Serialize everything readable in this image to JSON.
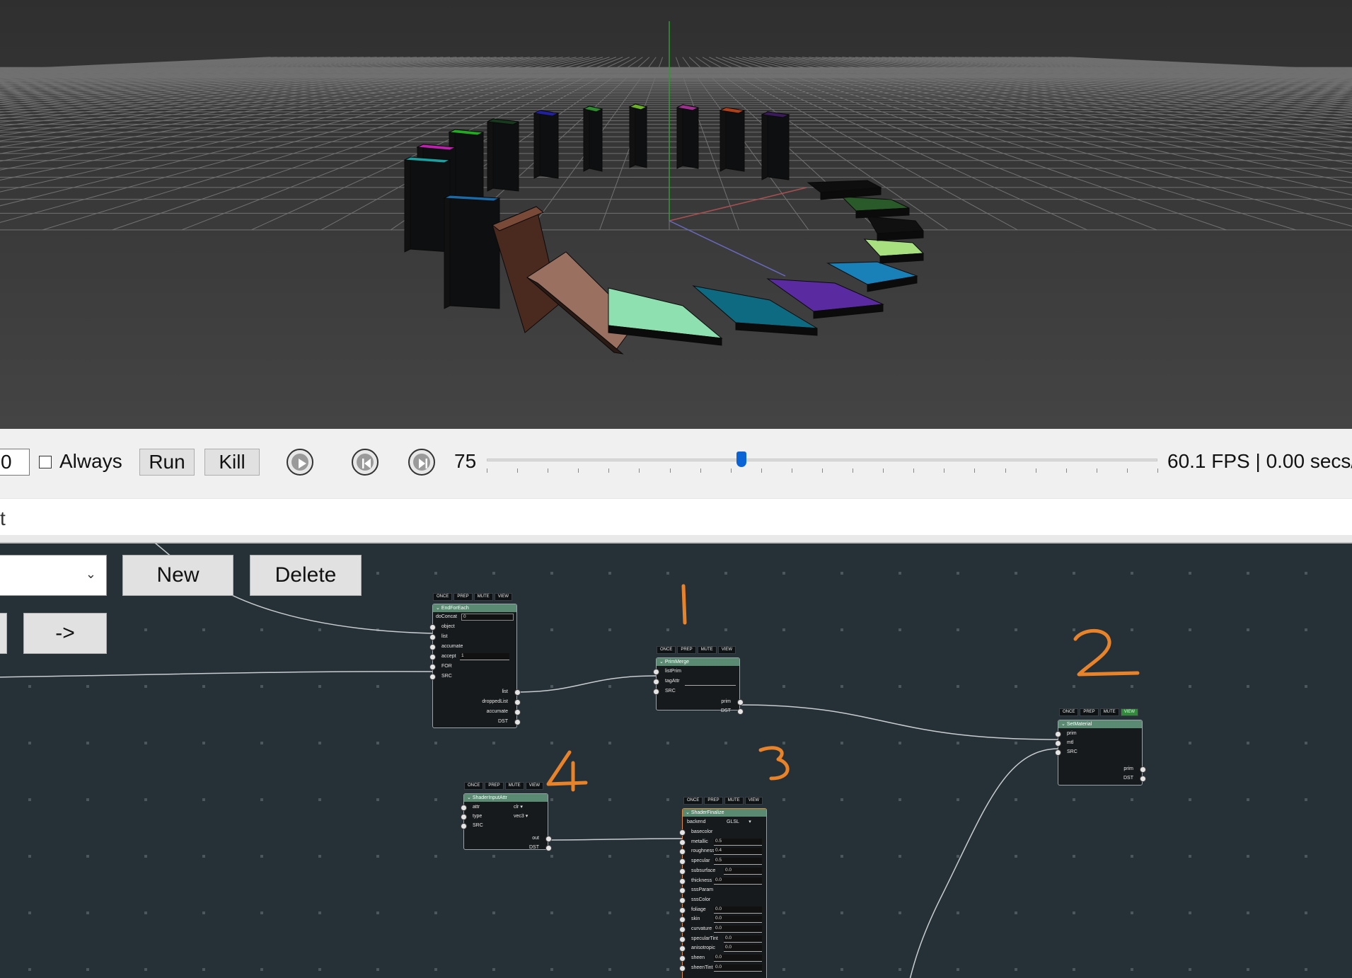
{
  "viewport": {
    "background": "#3a3a3a",
    "grid_color": "#8a8a8a",
    "axis_green": "#2e9a2e",
    "axis_red": "#a85050",
    "axis_blue": "#5050a8"
  },
  "toolbar": {
    "frame_input_value": "0",
    "always_label": "Always",
    "always_checked": false,
    "run_label": "Run",
    "kill_label": "Kill",
    "current_frame": "75",
    "slider_fraction": 0.38,
    "fps_text": "60.1 FPS | 0.00 secs/"
  },
  "command": {
    "caret_text": "t"
  },
  "graph": {
    "select_value": "",
    "new_label": "New",
    "delete_label": "Delete",
    "arrow_label": "->",
    "annotations": [
      "1",
      "2",
      "3",
      "4"
    ],
    "annotation_color": "#e8832a",
    "nodes": {
      "endforeach": {
        "tags": [
          "ONCE",
          "PREP",
          "MUTE",
          "VIEW"
        ],
        "title": "EndForEach",
        "doConcat_label": "doConcat",
        "doConcat_value": "0",
        "object": "object",
        "list": "list",
        "accumate": "accumate",
        "accept_label": "accept",
        "accept_value": "1",
        "for": "FOR",
        "src": "SRC",
        "out_list": "list",
        "out_dropped": "droppedList",
        "out_accumate": "accumate",
        "out_dst": "DST"
      },
      "primmerge": {
        "tags": [
          "ONCE",
          "PREP",
          "MUTE",
          "VIEW"
        ],
        "title": "PrimMerge",
        "listPrim": "listPrim",
        "tagAttr": "tagAttr",
        "src": "SRC",
        "out_prim": "prim",
        "out_dst": "DST"
      },
      "setmaterial": {
        "tags": [
          "ONCE",
          "PREP",
          "MUTE",
          "VIEW"
        ],
        "title": "SetMaterial",
        "prim": "prim",
        "mtl": "mtl",
        "src": "SRC",
        "out_prim": "prim",
        "out_dst": "DST"
      },
      "shaderinputattr": {
        "tags": [
          "ONCE",
          "PREP",
          "MUTE",
          "VIEW"
        ],
        "title": "ShaderInputAttr",
        "attr": "attr",
        "attr_value": "clr",
        "type": "type",
        "type_value": "vec3",
        "src": "SRC",
        "out": "out",
        "out_dst": "DST"
      },
      "shaderfinalize": {
        "tags": [
          "ONCE",
          "PREP",
          "MUTE",
          "VIEW"
        ],
        "title": "ShaderFinalize",
        "backend_label": "backend",
        "backend_value": "GLSL",
        "params": [
          {
            "name": "basecolor",
            "value": ""
          },
          {
            "name": "metallic",
            "value": "0.5"
          },
          {
            "name": "roughness",
            "value": "0.4"
          },
          {
            "name": "specular",
            "value": "0.5"
          },
          {
            "name": "subsurface",
            "value": "0.0"
          },
          {
            "name": "thickness",
            "value": "0.0"
          },
          {
            "name": "sssParam",
            "value": ""
          },
          {
            "name": "sssColor",
            "value": ""
          },
          {
            "name": "foliage",
            "value": "0.0"
          },
          {
            "name": "skin",
            "value": "0.0"
          },
          {
            "name": "curvature",
            "value": "0.0"
          },
          {
            "name": "specularTint",
            "value": "0.0"
          },
          {
            "name": "anisotropic",
            "value": "0.0"
          },
          {
            "name": "sheen",
            "value": "0.0"
          },
          {
            "name": "sheenTint",
            "value": "0.0"
          }
        ]
      }
    }
  }
}
